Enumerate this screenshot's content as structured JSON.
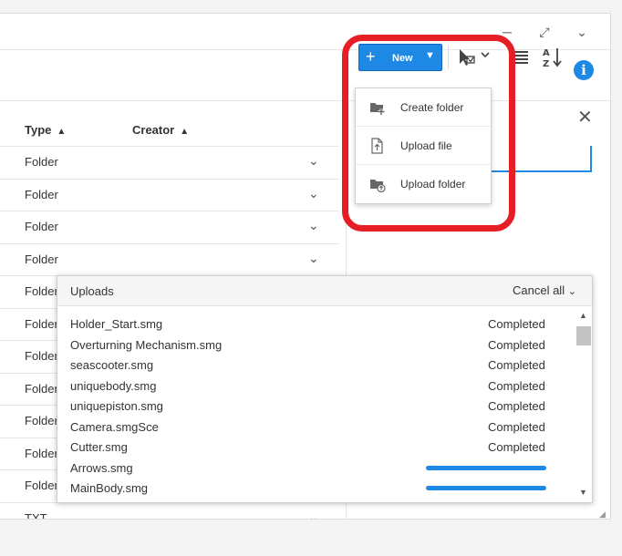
{
  "window": {
    "minimize_icon": "minimize-icon",
    "maximize_icon": "maximize-icon",
    "collapse_icon": "chevron-down-icon"
  },
  "toolbar": {
    "new_label": "New",
    "tools": [
      "select-icon",
      "list-view-icon",
      "sort-icon",
      "info-icon"
    ],
    "info_symbol": "i"
  },
  "table": {
    "columns": [
      {
        "label": "Type"
      },
      {
        "label": "Creator"
      }
    ],
    "rows": [
      {
        "type": "Folder"
      },
      {
        "type": "Folder"
      },
      {
        "type": "Folder"
      },
      {
        "type": "Folder"
      },
      {
        "type": "Folder"
      },
      {
        "type": "Folder"
      },
      {
        "type": "Folder"
      },
      {
        "type": "Folder"
      },
      {
        "type": "Folder"
      },
      {
        "type": "Folder"
      },
      {
        "type": "Folder"
      },
      {
        "type": "TXT"
      }
    ]
  },
  "new_menu": {
    "items": [
      {
        "label": "Create folder",
        "icon": "create-folder-icon"
      },
      {
        "label": "Upload file",
        "icon": "upload-file-icon"
      },
      {
        "label": "Upload folder",
        "icon": "upload-folder-icon"
      }
    ]
  },
  "uploads": {
    "title": "Uploads",
    "cancel_all": "Cancel all",
    "items": [
      {
        "name": "Holder_Start.smg",
        "status": "Completed"
      },
      {
        "name": "Overturning Mechanism.smg",
        "status": "Completed"
      },
      {
        "name": "seascooter.smg",
        "status": "Completed"
      },
      {
        "name": "uniquebody.smg",
        "status": "Completed"
      },
      {
        "name": "uniquepiston.smg",
        "status": "Completed"
      },
      {
        "name": "Camera.smgSce",
        "status": "Completed"
      },
      {
        "name": "Cutter.smg",
        "status": "Completed"
      },
      {
        "name": "Arrows.smg",
        "status": "",
        "progress": 1.0
      },
      {
        "name": "MainBody.smg",
        "status": "",
        "progress": 1.0
      }
    ]
  },
  "colors": {
    "accent": "#1e88e5",
    "highlight": "#e61f27"
  }
}
